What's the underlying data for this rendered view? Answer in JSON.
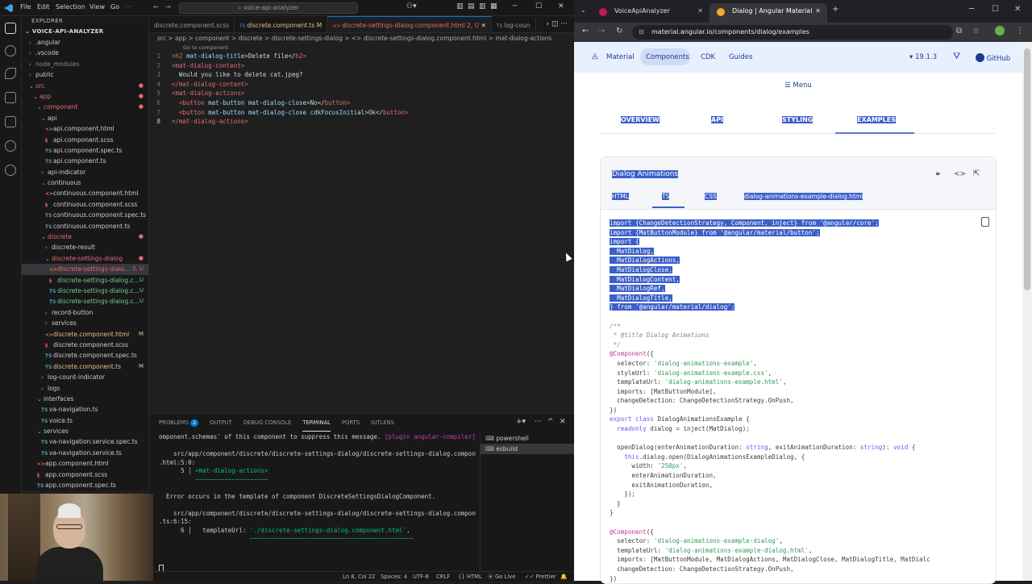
{
  "vscode": {
    "menu": [
      "File",
      "Edit",
      "Selection",
      "View",
      "Go"
    ],
    "search": "voice-api-analyzer",
    "explorer_title": "EXPLORER",
    "project": "VOICE-API-ANALYZER",
    "tree": [
      {
        "label": ".angular",
        "depth": 1,
        "type": "folder",
        "open": false
      },
      {
        "label": ".vscode",
        "depth": 1,
        "type": "folder",
        "open": false
      },
      {
        "label": "node_modules",
        "depth": 1,
        "type": "folder",
        "open": false,
        "muted": true
      },
      {
        "label": "public",
        "depth": 1,
        "type": "folder",
        "open": false
      },
      {
        "label": "src",
        "depth": 1,
        "type": "folder",
        "open": true,
        "color": "#e06c75",
        "status": "●"
      },
      {
        "label": "app",
        "depth": 2,
        "type": "folder",
        "open": true,
        "color": "#e06c75",
        "status": "●"
      },
      {
        "label": "component",
        "depth": 3,
        "type": "folder",
        "open": true,
        "color": "#e06c75",
        "status": "●"
      },
      {
        "label": "api",
        "depth": 4,
        "type": "folder",
        "open": true
      },
      {
        "label": "api.component.html",
        "depth": 5,
        "type": "html"
      },
      {
        "label": "api.component.scss",
        "depth": 5,
        "type": "scss"
      },
      {
        "label": "api.component.spec.ts",
        "depth": 5,
        "type": "ts"
      },
      {
        "label": "api.component.ts",
        "depth": 5,
        "type": "ts"
      },
      {
        "label": "api-indicator",
        "depth": 4,
        "type": "folder",
        "open": false
      },
      {
        "label": "continuous",
        "depth": 4,
        "type": "folder",
        "open": true
      },
      {
        "label": "continuous.component.html",
        "depth": 5,
        "type": "html"
      },
      {
        "label": "continuous.component.scss",
        "depth": 5,
        "type": "scss"
      },
      {
        "label": "continuous.component.spec.ts",
        "depth": 5,
        "type": "ts"
      },
      {
        "label": "continuous.component.ts",
        "depth": 5,
        "type": "ts"
      },
      {
        "label": "discrete",
        "depth": 4,
        "type": "folder",
        "open": true,
        "color": "#e06c75",
        "status": "●"
      },
      {
        "label": "discrete-result",
        "depth": 5,
        "type": "folder",
        "open": false
      },
      {
        "label": "discrete-settings-dialog",
        "depth": 5,
        "type": "folder",
        "open": true,
        "color": "#e06c75",
        "status": "●"
      },
      {
        "label": "discrete-settings-dialo...",
        "depth": 6,
        "type": "html",
        "color": "#e06c75",
        "status": "2, U",
        "selected": true
      },
      {
        "label": "discrete-settings-dialog.c...",
        "depth": 6,
        "type": "scss",
        "color": "#73c991",
        "status": "U"
      },
      {
        "label": "discrete-settings-dialog.c...",
        "depth": 6,
        "type": "ts",
        "color": "#73c991",
        "status": "U"
      },
      {
        "label": "discrete-settings-dialog.c...",
        "depth": 6,
        "type": "ts",
        "color": "#73c991",
        "status": "U"
      },
      {
        "label": "record-button",
        "depth": 5,
        "type": "folder",
        "open": false
      },
      {
        "label": "services",
        "depth": 5,
        "type": "folder",
        "open": false
      },
      {
        "label": "discrete.component.html",
        "depth": 5,
        "type": "html",
        "color": "#e2c08d",
        "status": "M"
      },
      {
        "label": "discrete.component.scss",
        "depth": 5,
        "type": "scss"
      },
      {
        "label": "discrete.component.spec.ts",
        "depth": 5,
        "type": "ts"
      },
      {
        "label": "discrete.component.ts",
        "depth": 5,
        "type": "ts",
        "color": "#e2c08d",
        "status": "M"
      },
      {
        "label": "log-count-indicator",
        "depth": 4,
        "type": "folder",
        "open": false
      },
      {
        "label": "logs",
        "depth": 4,
        "type": "folder",
        "open": false
      },
      {
        "label": "interfaces",
        "depth": 3,
        "type": "folder",
        "open": true
      },
      {
        "label": "va-navigation.ts",
        "depth": 4,
        "type": "ts"
      },
      {
        "label": "voice.ts",
        "depth": 4,
        "type": "ts"
      },
      {
        "label": "services",
        "depth": 3,
        "type": "folder",
        "open": true
      },
      {
        "label": "va-navigation.service.spec.ts",
        "depth": 4,
        "type": "ts"
      },
      {
        "label": "va-navigation.service.ts",
        "depth": 4,
        "type": "ts"
      },
      {
        "label": "app.component.html",
        "depth": 3,
        "type": "html"
      },
      {
        "label": "app.component.scss",
        "depth": 3,
        "type": "scss"
      },
      {
        "label": "app.component.spec.ts",
        "depth": 3,
        "type": "ts"
      }
    ],
    "tabs": [
      {
        "label": "discrete.component.scss",
        "prefix": "",
        "active": false
      },
      {
        "label": "discrete.component.ts M",
        "prefix": "TS",
        "active": false,
        "color": "#e2c08d"
      },
      {
        "label": "discrete-settings-dialog.component.html 2, U",
        "prefix": "<>",
        "active": true,
        "color": "#e06c75"
      },
      {
        "label": "log-coun",
        "prefix": "TS",
        "active": false
      }
    ],
    "breadcrumb": "src > app > component > discrete > discrete-settings-dialog > <> discrete-settings-dialog.component.html > mat-dialog-actions",
    "code_hint": "Go to component",
    "code": [
      [
        {
          "t": "<h2 ",
          "c": "tg"
        },
        {
          "t": "mat-dialog-title",
          "c": "at"
        },
        {
          "t": ">Delete file</",
          "c": "tx"
        },
        {
          "t": "h2>",
          "c": "tg"
        }
      ],
      [
        {
          "t": "<mat-dialog-content>",
          "c": "tg"
        }
      ],
      [
        {
          "t": "  Would you like to delete cat.jpeg?",
          "c": "tx"
        }
      ],
      [
        {
          "t": "</mat-dialog-content>",
          "c": "tg"
        }
      ],
      [
        {
          "t": "<mat-dialog-actions>",
          "c": "tg"
        }
      ],
      [
        {
          "t": "  <button ",
          "c": "tg"
        },
        {
          "t": "mat-button mat-dialog-close",
          "c": "at"
        },
        {
          "t": ">No</",
          "c": "tx"
        },
        {
          "t": "button>",
          "c": "tg"
        }
      ],
      [
        {
          "t": "  <button ",
          "c": "tg"
        },
        {
          "t": "mat-button mat-dialog-close cdkFocusInitial",
          "c": "at"
        },
        {
          "t": ">Ok</",
          "c": "tx"
        },
        {
          "t": "button>",
          "c": "tg"
        }
      ],
      [
        {
          "t": "</mat-dialog-actions>",
          "c": "tg"
        }
      ]
    ],
    "current_line": 8,
    "panel_tabs": [
      "PROBLEMS",
      "OUTPUT",
      "DEBUG CONSOLE",
      "TERMINAL",
      "PORTS",
      "GITLENS"
    ],
    "problems_count": "2",
    "terminal": [
      [
        {
          "t": "omponent.schemas' of this component to suppress this message. ",
          "c": ""
        },
        {
          "t": "[plugin angular-compiler]",
          "c": "mg"
        }
      ],
      [
        {
          "t": "",
          "c": ""
        }
      ],
      [
        {
          "t": "    src/app/component/discrete/discrete-settings-dialog/discrete-settings-dialog.component",
          "c": ""
        }
      ],
      [
        {
          "t": ".html:5:0:",
          "c": ""
        }
      ],
      [
        {
          "t": "      5 ",
          "c": ""
        },
        {
          "t": "│ ",
          "c": ""
        },
        {
          "t": "<mat-dialog-actions>",
          "c": "gr"
        }
      ],
      [
        {
          "t": "        ",
          "c": ""
        },
        {
          "t": "  ~~~~~~~~~~~~~~~~~~~~",
          "c": "gr"
        }
      ],
      [
        {
          "t": "",
          "c": ""
        }
      ],
      [
        {
          "t": "  Error occurs in the template of component DiscreteSettingsDialogComponent.",
          "c": ""
        }
      ],
      [
        {
          "t": "",
          "c": ""
        }
      ],
      [
        {
          "t": "    src/app/component/discrete/discrete-settings-dialog/discrete-settings-dialog.component",
          "c": ""
        }
      ],
      [
        {
          "t": ".ts:6:15:",
          "c": ""
        }
      ],
      [
        {
          "t": "      6 ",
          "c": ""
        },
        {
          "t": "│   templateUrl: ",
          "c": ""
        },
        {
          "t": "'./discrete-settings-dialog.component.html'",
          "c": "gr"
        },
        {
          "t": ",",
          "c": ""
        }
      ],
      [
        {
          "t": "        ",
          "c": ""
        },
        {
          "t": "                 ~~~~~~~~~~~~~~~~~~~~~~~~~~~~~~~~~~~~~~~~~~~~~",
          "c": "gr"
        }
      ]
    ],
    "terminals": [
      "powershell",
      "esbuild"
    ],
    "status": {
      "position": "Ln 8, Col 22",
      "spaces": "Spaces: 4",
      "encoding": "UTF-8",
      "eol": "CRLF",
      "lang": "HTML",
      "golive": "Go Live",
      "prettier": "Prettier"
    }
  },
  "browser": {
    "tabs": [
      "VoiceApiAnalyzer",
      "Dialog | Angular Material"
    ],
    "url": "material.angular.io/components/dialog/examples",
    "nav": [
      "Material",
      "Components",
      "CDK",
      "Guides"
    ],
    "version": "19.1.3",
    "github": "GitHub",
    "menu": "Menu",
    "subnav": [
      "OVERVIEW",
      "API",
      "STYLING",
      "EXAMPLES"
    ],
    "card_title": "Dialog Animations",
    "code_tabs": [
      "HTML",
      "TS",
      "CSS",
      "dialog-animations-example-dialog.html"
    ],
    "code": [
      {
        "hl": true,
        "p": [
          {
            "t": "import {ChangeDetectionStrategy, Component, inject} from '@angular/core';",
            "c": ""
          }
        ]
      },
      {
        "hl": true,
        "p": [
          {
            "t": "import {MatButtonModule} from '@angular/material/button';",
            "c": ""
          }
        ]
      },
      {
        "hl": true,
        "p": [
          {
            "t": "import {",
            "c": ""
          }
        ]
      },
      {
        "hl": true,
        "p": [
          {
            "t": "  MatDialog,",
            "c": ""
          }
        ]
      },
      {
        "hl": true,
        "p": [
          {
            "t": "  MatDialogActions,",
            "c": ""
          }
        ]
      },
      {
        "hl": true,
        "p": [
          {
            "t": "  MatDialogClose,",
            "c": ""
          }
        ]
      },
      {
        "hl": true,
        "p": [
          {
            "t": "  MatDialogContent,",
            "c": ""
          }
        ]
      },
      {
        "hl": true,
        "p": [
          {
            "t": "  MatDialogRef,",
            "c": ""
          }
        ]
      },
      {
        "hl": true,
        "p": [
          {
            "t": "  MatDialogTitle,",
            "c": ""
          }
        ]
      },
      {
        "hl": true,
        "p": [
          {
            "t": "} from '@angular/material/dialog';",
            "c": ""
          }
        ]
      },
      {
        "hl": false,
        "p": [
          {
            "t": "",
            "c": ""
          }
        ]
      },
      {
        "hl": false,
        "p": [
          {
            "t": "/**",
            "c": "c"
          }
        ]
      },
      {
        "hl": false,
        "p": [
          {
            "t": " * @title Dialog Animations",
            "c": "c"
          }
        ]
      },
      {
        "hl": false,
        "p": [
          {
            "t": " */",
            "c": "c"
          }
        ]
      },
      {
        "hl": false,
        "p": [
          {
            "t": "@Component",
            "c": "d"
          },
          {
            "t": "({",
            "c": ""
          }
        ]
      },
      {
        "hl": false,
        "p": [
          {
            "t": "  selector: ",
            "c": ""
          },
          {
            "t": "'dialog-animations-example'",
            "c": "s"
          },
          {
            "t": ",",
            "c": ""
          }
        ]
      },
      {
        "hl": false,
        "p": [
          {
            "t": "  styleUrl: ",
            "c": ""
          },
          {
            "t": "'dialog-animations-example.css'",
            "c": "s"
          },
          {
            "t": ",",
            "c": ""
          }
        ]
      },
      {
        "hl": false,
        "p": [
          {
            "t": "  templateUrl: ",
            "c": ""
          },
          {
            "t": "'dialog-animations-example.html'",
            "c": "s"
          },
          {
            "t": ",",
            "c": ""
          }
        ]
      },
      {
        "hl": false,
        "p": [
          {
            "t": "  imports: [MatButtonModule],",
            "c": ""
          }
        ]
      },
      {
        "hl": false,
        "p": [
          {
            "t": "  changeDetection: ChangeDetectionStrategy.OnPush,",
            "c": ""
          }
        ]
      },
      {
        "hl": false,
        "p": [
          {
            "t": "})",
            "c": ""
          }
        ]
      },
      {
        "hl": false,
        "p": [
          {
            "t": "export class ",
            "c": "k"
          },
          {
            "t": "DialogAnimationsExample {",
            "c": ""
          }
        ]
      },
      {
        "hl": false,
        "p": [
          {
            "t": "  readonly ",
            "c": "k"
          },
          {
            "t": "dialog = inject(MatDialog);",
            "c": ""
          }
        ]
      },
      {
        "hl": false,
        "p": [
          {
            "t": "",
            "c": ""
          }
        ]
      },
      {
        "hl": false,
        "p": [
          {
            "t": "  openDialog(enterAnimationDuration: ",
            "c": ""
          },
          {
            "t": "string",
            "c": "k"
          },
          {
            "t": ", exitAnimationDuration: ",
            "c": ""
          },
          {
            "t": "string",
            "c": "k"
          },
          {
            "t": "): ",
            "c": ""
          },
          {
            "t": "void",
            "c": "k"
          },
          {
            "t": " {",
            "c": ""
          }
        ]
      },
      {
        "hl": false,
        "p": [
          {
            "t": "    this",
            "c": "k"
          },
          {
            "t": ".dialog.open(DialogAnimationsExampleDialog, {",
            "c": ""
          }
        ]
      },
      {
        "hl": false,
        "p": [
          {
            "t": "      width: ",
            "c": ""
          },
          {
            "t": "'250px'",
            "c": "s"
          },
          {
            "t": ",",
            "c": ""
          }
        ]
      },
      {
        "hl": false,
        "p": [
          {
            "t": "      enterAnimationDuration,",
            "c": ""
          }
        ]
      },
      {
        "hl": false,
        "p": [
          {
            "t": "      exitAnimationDuration,",
            "c": ""
          }
        ]
      },
      {
        "hl": false,
        "p": [
          {
            "t": "    });",
            "c": ""
          }
        ]
      },
      {
        "hl": false,
        "p": [
          {
            "t": "  }",
            "c": ""
          }
        ]
      },
      {
        "hl": false,
        "p": [
          {
            "t": "}",
            "c": ""
          }
        ]
      },
      {
        "hl": false,
        "p": [
          {
            "t": "",
            "c": ""
          }
        ]
      },
      {
        "hl": false,
        "p": [
          {
            "t": "@Component",
            "c": "d"
          },
          {
            "t": "({",
            "c": ""
          }
        ]
      },
      {
        "hl": false,
        "p": [
          {
            "t": "  selector: ",
            "c": ""
          },
          {
            "t": "'dialog-animations-example-dialog'",
            "c": "s"
          },
          {
            "t": ",",
            "c": ""
          }
        ]
      },
      {
        "hl": false,
        "p": [
          {
            "t": "  templateUrl: ",
            "c": ""
          },
          {
            "t": "'dialog-animations-example-dialog.html'",
            "c": "s"
          },
          {
            "t": ",",
            "c": ""
          }
        ]
      },
      {
        "hl": false,
        "p": [
          {
            "t": "  imports: [MatButtonModule, MatDialogActions, MatDialogClose, MatDialogTitle, MatDialc",
            "c": ""
          }
        ]
      },
      {
        "hl": false,
        "p": [
          {
            "t": "  changeDetection: ChangeDetectionStrategy.OnPush,",
            "c": ""
          }
        ]
      },
      {
        "hl": false,
        "p": [
          {
            "t": "})",
            "c": ""
          }
        ]
      }
    ]
  }
}
